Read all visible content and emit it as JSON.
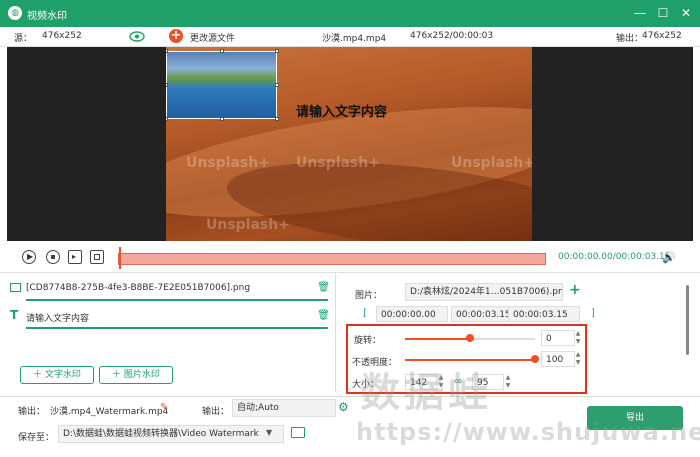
{
  "window": {
    "title": "视频水印"
  },
  "info": {
    "source_label": "源：",
    "source_res": "476x252",
    "change_source": "更改源文件",
    "filename": "沙漠.mp4.mp4",
    "res_time": "476x252/00:00:03",
    "output_label": "输出：",
    "output_res": "476x252"
  },
  "preview": {
    "overlay_text": "请输入文字内容",
    "watermark_text": "Unsplash+"
  },
  "playback": {
    "time": "00:00:00.00/00:00:03.15"
  },
  "list": {
    "items": [
      {
        "label": "[CD8774B8-275B-4fe3-B8BE-7E2E051B7006].png",
        "icon": "image-icon"
      },
      {
        "label": "请输入文字内容",
        "icon": "text-icon"
      }
    ],
    "add_text_button": "文字水印",
    "add_image_button": "图片水印"
  },
  "props": {
    "image_label": "图片：",
    "image_path": "D:/袁林炫/2024年1…051B7006).png",
    "time_start": "00:00:00.00",
    "time_end1": "00:00:03.15",
    "time_end2": "00:00:03.15",
    "rotate_label": "旋转：",
    "rotate_value": "0",
    "rotate_level": 0.5,
    "opacity_label": "不透明度：",
    "opacity_value": "100",
    "opacity_level": 1.0,
    "size_label": "大小：",
    "width": "142",
    "height": "95"
  },
  "bottom": {
    "output_label": "输出：",
    "output_name": "沙漠.mp4_Watermark.mp4",
    "format_label": "输出：",
    "format_value": "自动;Auto",
    "save_label": "保存至：",
    "save_path": "D:\\数据蛙\\数据蛙视频转换器\\Video Watermark",
    "export_button": "导出"
  },
  "site_watermark": {
    "cn": "数据蛙",
    "url": "https://www.shujuwa.net"
  },
  "colors": {
    "accent": "#1f9f6a",
    "highlight": "#f04e23",
    "annotation": "#e0301e"
  }
}
